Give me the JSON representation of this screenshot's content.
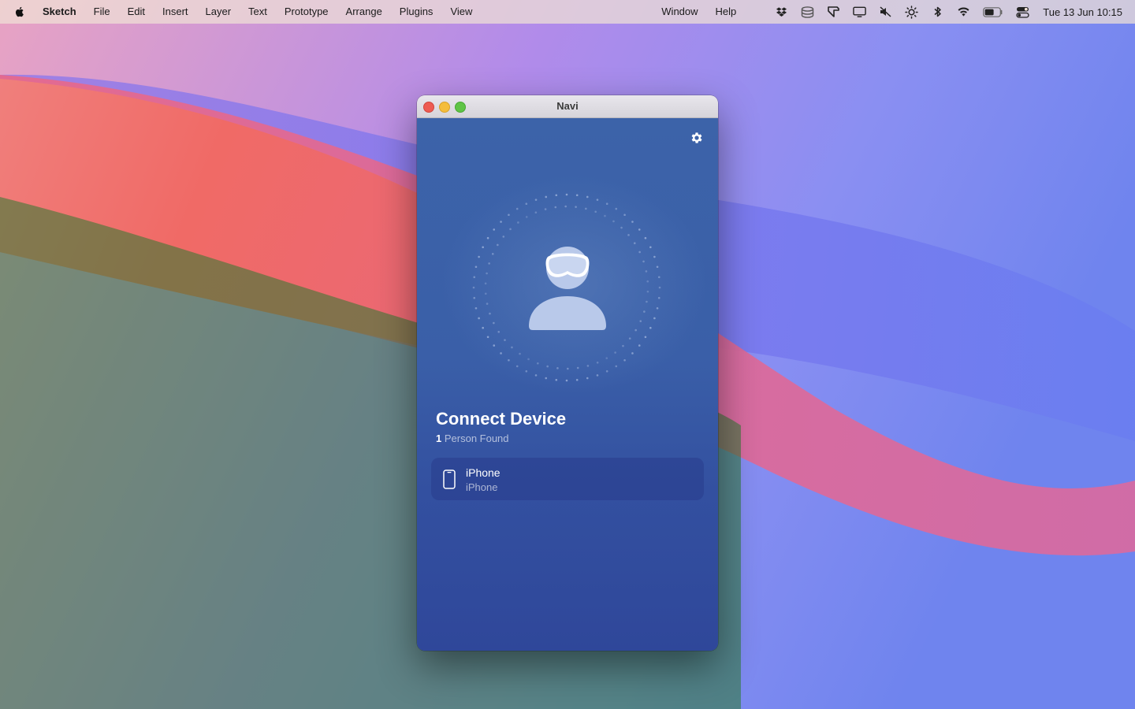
{
  "menubar": {
    "app_name": "Sketch",
    "menus": [
      "File",
      "Edit",
      "Insert",
      "Layer",
      "Text",
      "Prototype",
      "Arrange",
      "Plugins",
      "View"
    ],
    "right_menus": [
      "Window",
      "Help"
    ],
    "status_icons": [
      "dropbox-icon",
      "database-icon",
      "cursor-app-icon",
      "display-icon",
      "speaker-muted-icon",
      "brightness-icon",
      "bluetooth-icon",
      "wifi-icon",
      "battery-icon",
      "control-center-icon"
    ],
    "clock": "Tue 13 Jun  10:15"
  },
  "window": {
    "title": "Navi",
    "heading": "Connect Device",
    "found_count": "1",
    "found_label": "Person Found",
    "devices": [
      {
        "name": "iPhone",
        "type": "iPhone",
        "icon": "iphone-icon"
      }
    ]
  },
  "colors": {
    "panel_top": "#3c63a9",
    "panel_bottom": "#2f479a",
    "close": "#ee5b52",
    "minimize": "#f4bd3c",
    "maximize": "#5fc446"
  }
}
